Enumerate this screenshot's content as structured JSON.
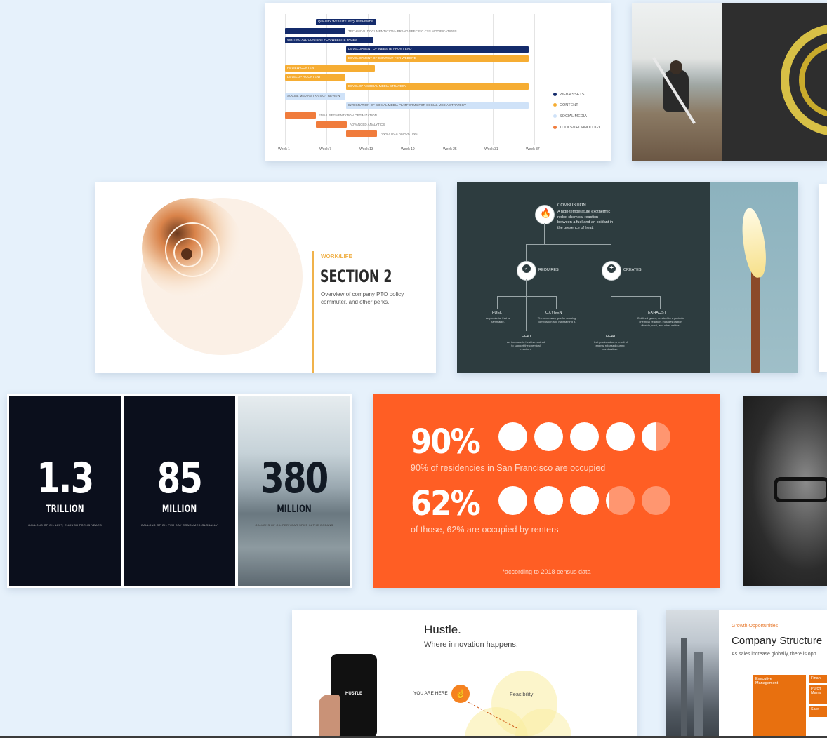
{
  "gantt": {
    "bars": [
      {
        "label": "QUALIFY WEBSITE REQUIREMENTS",
        "color": "#142b6b"
      },
      {
        "label": "TECHNICAL DOCUMENTATION - BRAND SPECIFIC CSS MODIFICATIONS",
        "color": "#142b6b"
      },
      {
        "label": "WRITING ALL CONTENT FOR WEBSITE PAGES",
        "color": "#142b6b"
      },
      {
        "label": "DEVELOPMENT OF WEBSITE FRONT END",
        "color": "#142b6b"
      },
      {
        "label": "DEVELOPMENT OF CONTENT FOR WEBSITE",
        "color": "#f6ad33"
      },
      {
        "label": "REVIEW CONTENT",
        "color": "#f6ad33"
      },
      {
        "label": "DEVELOP A CONTENT",
        "color": "#f6ad33"
      },
      {
        "label": "DEVELOP A SOCIAL MEDIA STRATEGY",
        "color": "#f6ad33"
      },
      {
        "label": "SOCIAL MEDIA STRATEGY REVIEW",
        "color": "#cfe2f8"
      },
      {
        "label": "INTEGRATION OF SOCIAL MEDIA PLATFORMS FOR SOCIAL MEDIA STRATEGY",
        "color": "#cfe2f8"
      },
      {
        "label": "EMAIL SEGMENTATION OPTIMIZATION",
        "color": "#f07c3c"
      },
      {
        "label": "ADVANCED ANALYTICS",
        "color": "#f07c3c"
      },
      {
        "label": "ANALYTICS REPORTING",
        "color": "#f07c3c"
      }
    ],
    "weeks": [
      "Week 1",
      "Week 7",
      "Week 13",
      "Week 19",
      "Week 25",
      "Week 31",
      "Week 37"
    ],
    "legend": [
      {
        "label": "WEB ASSETS",
        "color": "#142b6b"
      },
      {
        "label": "CONTENT",
        "color": "#f6ad33"
      },
      {
        "label": "SOCIAL MEDIA",
        "color": "#cfe2f8"
      },
      {
        "label": "TOOLS/TECHNOLOGY",
        "color": "#f07c3c"
      }
    ]
  },
  "section_slide": {
    "kicker": "WORK/LIFE",
    "title": "SECTION 2",
    "body": "Overview of company PTO policy, commuter, and other perks."
  },
  "combustion": {
    "title": "COMBUSTION",
    "description": "A high-temperature exothermic redox chemical reaction between a fuel and an oxidant in the presence of heat.",
    "requires": "REQUIRES",
    "creates": "CREATES",
    "leaves": [
      {
        "title": "FUEL",
        "text": "Any material that is flammable."
      },
      {
        "title": "OXYGEN",
        "text": "The necessary gas for causing combustion and maintaining it."
      },
      {
        "title": "HEAT",
        "text": "An increase in heat is required to support the chemical reaction."
      },
      {
        "title": "HEAT",
        "text": "Heat produced as a result of energy released during combustion."
      },
      {
        "title": "EXHAUST",
        "text": "Oxidized gases, created by a periodic chemical reaction, includes carbon dioxide, soot, and other oxides."
      }
    ]
  },
  "stats": [
    {
      "number": "1.3",
      "unit": "TRILLION",
      "caption": "GALLONS OF OIL LEFT, ENOUGH FOR 45 YEARS"
    },
    {
      "number": "85",
      "unit": "MILLION",
      "caption": "GALLONS OF OIL PER DAY CONSUMED GLOBALLY"
    },
    {
      "number": "380",
      "unit": "MILLION",
      "caption": "GALLONS OF OIL PER YEAR SPILT IN THE OCEANS"
    }
  ],
  "occupancy": {
    "rows": [
      {
        "percent": "90%",
        "value": 90,
        "caption": "90% of residencies in San Francisco are occupied"
      },
      {
        "percent": "62%",
        "value": 62,
        "caption": "of those, 62% are occupied by renters"
      }
    ],
    "footnote": "*according to 2018 census data",
    "bg_color": "#ff5e24"
  },
  "hustle": {
    "title": "Hustle.",
    "subtitle": "Where innovation happens.",
    "phone_label": "HUSTLE",
    "marker_label": "YOU ARE HERE",
    "bubble_label": "Feasibility"
  },
  "company": {
    "kicker": "Growth Opportunities",
    "title": "Company Structure",
    "body": "As sales increase globally, there is opp",
    "box1": "Executive Management",
    "box2": "Finan",
    "box3": "Purch Mana",
    "box4": "Sale"
  }
}
